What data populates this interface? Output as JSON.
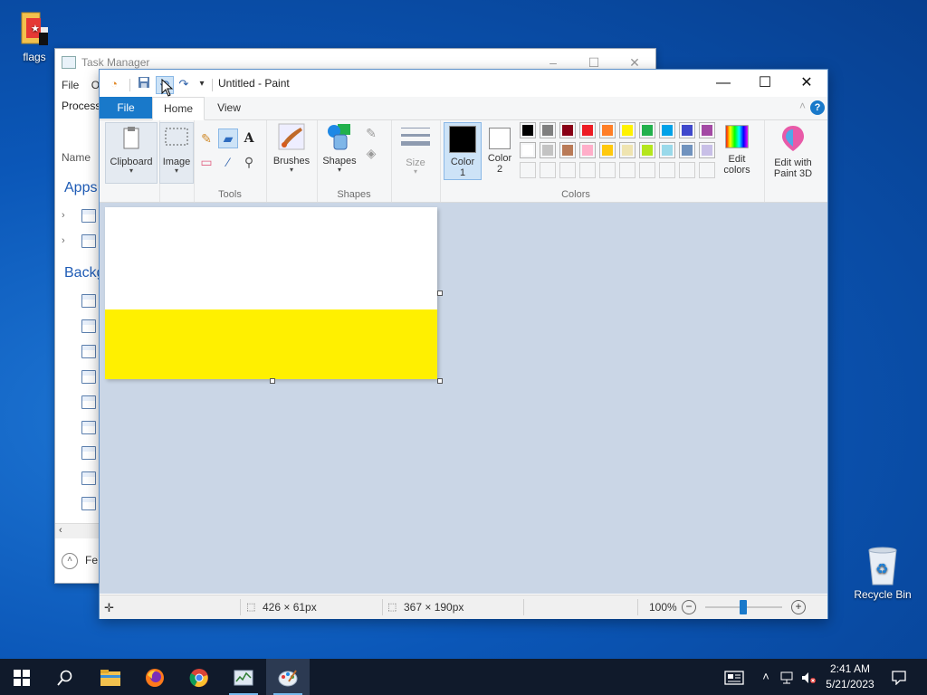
{
  "desktop": {
    "icons": [
      {
        "label": "flags"
      },
      {
        "label": "Recycle Bin"
      }
    ]
  },
  "task_manager": {
    "title": "Task Manager",
    "menu_file": "File",
    "menu_options": "O",
    "tab_processes": "Process",
    "column_name": "Name",
    "group_apps": "Apps",
    "group_background": "Backg",
    "fewer_details": "Fe"
  },
  "paint": {
    "title": "Untitled - Paint",
    "tabs": {
      "file": "File",
      "home": "Home",
      "view": "View"
    },
    "ribbon": {
      "clipboard": "Clipboard",
      "image": "Image",
      "tools_label": "Tools",
      "brushes": "Brushes",
      "shapes": "Shapes",
      "shapes_label": "Shapes",
      "size": "Size",
      "color1_line1": "Color",
      "color1_line2": "1",
      "color2_line1": "Color",
      "color2_line2": "2",
      "colors_label": "Colors",
      "edit_colors_line1": "Edit",
      "edit_colors_line2": "colors",
      "paint3d_line1": "Edit with",
      "paint3d_line2": "Paint 3D"
    },
    "color1": "#000000",
    "color2": "#ffffff",
    "palette_row1": [
      "#000000",
      "#7f7f7f",
      "#880015",
      "#ed1c24",
      "#ff7f27",
      "#fff200",
      "#22b14c",
      "#00a2e8",
      "#3f48cc",
      "#a349a4"
    ],
    "palette_row2": [
      "#ffffff",
      "#c3c3c3",
      "#b97a57",
      "#ffaec9",
      "#ffc90e",
      "#efe4b0",
      "#b5e61d",
      "#99d9ea",
      "#7092be",
      "#c8bfe7"
    ],
    "canvas": {
      "top_color": "#ffffff",
      "fill_color": "#fff000",
      "fill_fraction": 0.405
    },
    "status": {
      "selection_size": "426 × 61px",
      "canvas_size": "367 × 190px",
      "zoom": "100%"
    }
  },
  "taskbar": {
    "time": "2:41 AM",
    "date": "5/21/2023"
  }
}
